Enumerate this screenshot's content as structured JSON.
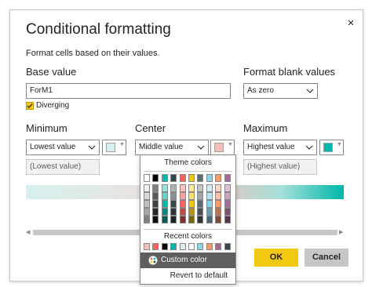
{
  "dialog": {
    "title": "Conditional formatting",
    "subtitle": "Format cells based on their values.",
    "close_icon": "×"
  },
  "base_value": {
    "label": "Base value",
    "value": "ForM1"
  },
  "format_blank": {
    "label": "Format blank values",
    "value": "As zero"
  },
  "diverging": {
    "label": "Diverging",
    "checked": true
  },
  "minimum": {
    "label": "Minimum",
    "select": "Lowest value",
    "color": "#d6f1ee",
    "value_placeholder": "(Lowest value)"
  },
  "center": {
    "label": "Center",
    "select": "Middle value",
    "color": "#f4c0b8"
  },
  "maximum": {
    "label": "Maximum",
    "select": "Highest value",
    "color": "#01b8aa",
    "value_placeholder": "(Highest value)"
  },
  "buttons": {
    "ok": "OK",
    "cancel": "Cancel"
  },
  "color_picker": {
    "theme_header": "Theme colors",
    "recent_header": "Recent colors",
    "custom_color": "Custom color",
    "revert": "Revert to default",
    "theme_top": [
      "#ffffff",
      "#000000",
      "#01b8aa",
      "#374649",
      "#fd625e",
      "#f2c80f",
      "#5f6b6d",
      "#8ad4eb",
      "#fe9666",
      "#a66999"
    ],
    "theme_columns": [
      [
        "#f2f2f2",
        "#d9d9d9",
        "#bfbfbf",
        "#a6a6a6",
        "#7f7f7f"
      ],
      [
        "#7f7f7f",
        "#595959",
        "#404040",
        "#262626",
        "#0d0d0d"
      ],
      [
        "#99e3dd",
        "#66d4cc",
        "#01b8aa",
        "#018a80",
        "#005c55"
      ],
      [
        "#afb5b6",
        "#879093",
        "#374649",
        "#293537",
        "#1c2325"
      ],
      [
        "#fec0bf",
        "#fea19e",
        "#fd625e",
        "#be4a47",
        "#7e312f"
      ],
      [
        "#fae99f",
        "#f7de6f",
        "#f2c80f",
        "#b6960b",
        "#796408"
      ],
      [
        "#bfc4c5",
        "#9fa6a7",
        "#5f6b6d",
        "#475052",
        "#303637"
      ],
      [
        "#d0eef7",
        "#b9e5f3",
        "#8ad4eb",
        "#689fb0",
        "#456a76"
      ],
      [
        "#fed5c2",
        "#fec0a3",
        "#fe9666",
        "#bf714d",
        "#7f4b33"
      ],
      [
        "#dbc3d6",
        "#caa5c2",
        "#a66999",
        "#7d4f73",
        "#53344d"
      ]
    ],
    "recent": [
      "#f4c0b8",
      "#fd625e",
      "#000000",
      "#01b8aa",
      "#d6f1ee",
      "#ffffff",
      "#8ad4eb",
      "#fe9666",
      "#a66999",
      "#374649"
    ]
  }
}
